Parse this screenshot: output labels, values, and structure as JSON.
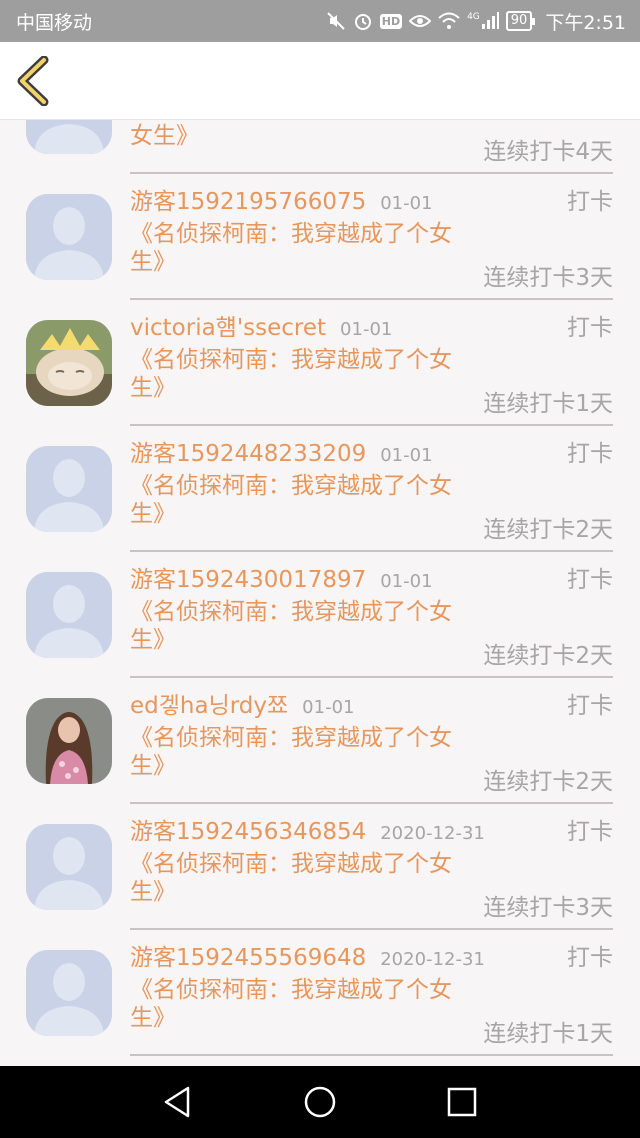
{
  "status_bar": {
    "carrier": "中国移动",
    "network": "4G",
    "battery": "90",
    "time": "下午2:51"
  },
  "header": {
    "back_icon": "chevron-left-icon"
  },
  "list": [
    {
      "name": "",
      "date": "",
      "action": "",
      "book": "女生》",
      "streak": "连续打卡4天",
      "avatar": "default"
    },
    {
      "name": "游客1592195766075",
      "date": "01-01",
      "action": "打卡",
      "book": "《名侦探柯南：我穿越成了个女生》",
      "streak": "连续打卡3天",
      "avatar": "default"
    },
    {
      "name": "victoria햼'ssecret",
      "date": "01-01",
      "action": "打卡",
      "book": "《名侦探柯南：我穿越成了个女生》",
      "streak": "连续打卡1天",
      "avatar": "cat-photo"
    },
    {
      "name": "游客1592448233209",
      "date": "01-01",
      "action": "打卡",
      "book": "《名侦探柯南：我穿越成了个女生》",
      "streak": "连续打卡2天",
      "avatar": "default"
    },
    {
      "name": "游客1592430017897",
      "date": "01-01",
      "action": "打卡",
      "book": "《名侦探柯南：我穿越成了个女生》",
      "streak": "连续打卡2天",
      "avatar": "default"
    },
    {
      "name": "ed겧ha닝rdy쬬",
      "date": "01-01",
      "action": "打卡",
      "book": "《名侦探柯南：我穿越成了个女生》",
      "streak": "连续打卡2天",
      "avatar": "girl-photo"
    },
    {
      "name": "游客1592456346854",
      "date": "2020-12-31",
      "action": "打卡",
      "book": "《名侦探柯南：我穿越成了个女生》",
      "streak": "连续打卡3天",
      "avatar": "default"
    },
    {
      "name": "游客1592455569648",
      "date": "2020-12-31",
      "action": "打卡",
      "book": "《名侦探柯南：我穿越成了个女生》",
      "streak": "连续打卡1天",
      "avatar": "default"
    },
    {
      "name": "",
      "date": "",
      "action": "",
      "book": "",
      "streak": "",
      "avatar": "default"
    }
  ],
  "nav_bar": {
    "back": "triangle-back-icon",
    "home": "circle-home-icon",
    "recent": "square-recent-icon"
  },
  "colors": {
    "accent": "#e6975d",
    "muted": "#a6a6a6",
    "avatar_default": "#c9d2e6"
  }
}
